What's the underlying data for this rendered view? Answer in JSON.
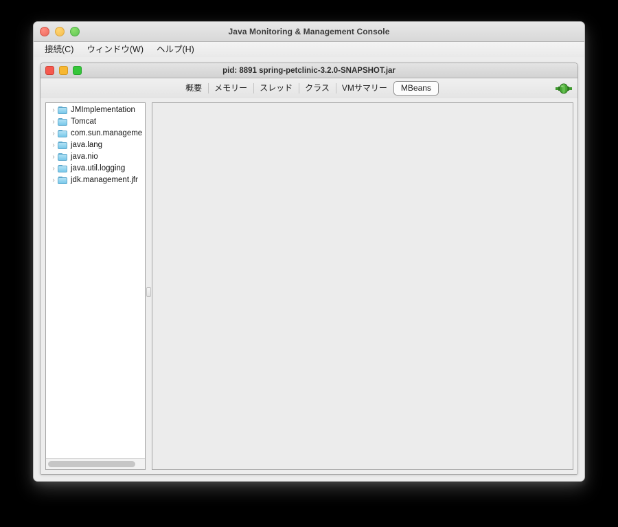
{
  "window": {
    "title": "Java Monitoring & Management Console",
    "traffic_lights": [
      "close-button",
      "minimize-button",
      "zoom-button"
    ]
  },
  "menubar": {
    "items": [
      {
        "label": "接続(C)",
        "name": "menu-connection"
      },
      {
        "label": "ウィンドウ(W)",
        "name": "menu-window"
      },
      {
        "label": "ヘルプ(H)",
        "name": "menu-help"
      }
    ]
  },
  "inner_window": {
    "title": "pid: 8891 spring-petclinic-3.2.0-SNAPSHOT.jar",
    "traffic_lights": [
      "close-button",
      "minimize-button",
      "zoom-button"
    ]
  },
  "tabs": {
    "items": [
      {
        "label": "概要",
        "name": "tab-overview",
        "selected": false
      },
      {
        "label": "メモリー",
        "name": "tab-memory",
        "selected": false
      },
      {
        "label": "スレッド",
        "name": "tab-threads",
        "selected": false
      },
      {
        "label": "クラス",
        "name": "tab-classes",
        "selected": false
      },
      {
        "label": "VMサマリー",
        "name": "tab-vm-summary",
        "selected": false
      },
      {
        "label": "MBeans",
        "name": "tab-mbeans",
        "selected": true
      }
    ],
    "selected": "MBeans",
    "connection_status": "connected",
    "connection_color": "#3f9a2e"
  },
  "mbean_tree": {
    "nodes": [
      {
        "label": "JMImplementation",
        "expanded": false
      },
      {
        "label": "Tomcat",
        "expanded": false
      },
      {
        "label": "com.sun.manageme",
        "expanded": false
      },
      {
        "label": "java.lang",
        "expanded": false
      },
      {
        "label": "java.nio",
        "expanded": false
      },
      {
        "label": "java.util.logging",
        "expanded": false
      },
      {
        "label": "jdk.management.jfr",
        "expanded": false
      }
    ],
    "twisty_glyph": "›",
    "folder_icon": "folder-icon",
    "scrollbar": "horizontal-scrollbar"
  },
  "detail_panel": {
    "content": ""
  },
  "colors": {
    "folder": "#79c8ea",
    "accent_green": "#3f9a2e",
    "window_bg": "#ececec",
    "panel_bg": "#ffffff"
  }
}
